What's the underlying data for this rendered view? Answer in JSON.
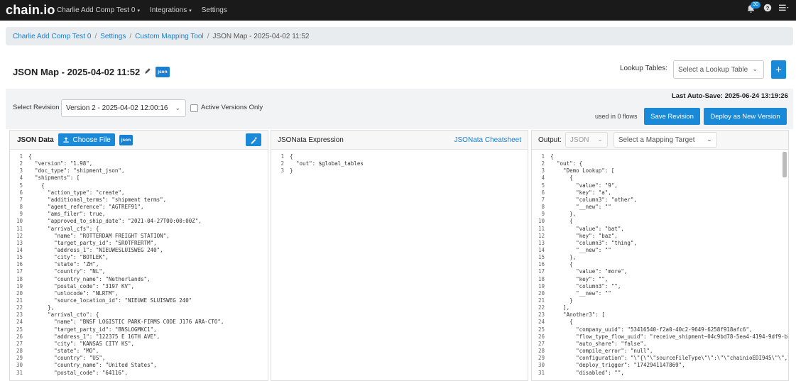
{
  "topbar": {
    "logo": "chain.io",
    "nav": [
      {
        "label": "Charlie Add Comp Test 0",
        "caret": true
      },
      {
        "label": "Integrations",
        "caret": true
      },
      {
        "label": "Settings",
        "caret": false
      }
    ],
    "notif_count": "30"
  },
  "breadcrumb": [
    "Charlie Add Comp Test 0",
    "Settings",
    "Custom Mapping Tool",
    "JSON Map - 2025-04-02 11:52"
  ],
  "header": {
    "title": "JSON Map - 2025-04-02 11:52",
    "tag": "json",
    "lookup_label": "Lookup Tables:",
    "lookup_placeholder": "Select a Lookup Table"
  },
  "toolbar": {
    "revision_label": "Select Revision",
    "revision_value": "Version 2 - 2025-04-02 12:00:16",
    "active_only_label": "Active Versions Only",
    "autosave": "Last Auto-Save: 2025-06-24 13:19:26",
    "flows": "used in 0 flows",
    "save_label": "Save Revision",
    "deploy_label": "Deploy as New Version"
  },
  "panels": {
    "json_data": {
      "title": "JSON Data",
      "choose_file": "Choose File",
      "tag": "json",
      "lines": [
        "{",
        "  \"version\": \"1.98\",",
        "  \"doc_type\": \"shipment_json\",",
        "  \"shipments\": [",
        "    {",
        "      \"action_type\": \"create\",",
        "      \"additional_terms\": \"shipment terms\",",
        "      \"agent_reference\": \"AGTREF91\",",
        "      \"ams_filer\": true,",
        "      \"approved_to_ship_date\": \"2021-04-27T00:00:00Z\",",
        "      \"arrival_cfs\": {",
        "        \"name\": \"ROTTERDAM FREIGHT STATION\",",
        "        \"target_party_id\": \"SROTFRERTM\",",
        "        \"address_1\": \"NIEUWESLUISWEG 240\",",
        "        \"city\": \"BOTLEK\",",
        "        \"state\": \"ZH\",",
        "        \"country\": \"NL\",",
        "        \"country_name\": \"Netherlands\",",
        "        \"postal_code\": \"3197 KV\",",
        "        \"unlocode\": \"NLRTM\",",
        "        \"source_location_id\": \"NIEUWE SLUISWEG 240\"",
        "      },",
        "      \"arrival_cto\": {",
        "        \"name\": \"BNSF LOGISTIC PARK-FIRMS CODE J176 ARA-CTO\",",
        "        \"target_party_id\": \"BNSLOGMKC1\",",
        "        \"address_1\": \"122375 E 16TH AVE\",",
        "        \"city\": \"KANSAS CITY KS\",",
        "        \"state\": \"MO\",",
        "        \"country\": \"US\",",
        "        \"country_name\": \"United States\",",
        "        \"postal_code\": \"64116\","
      ]
    },
    "jsonata": {
      "title": "JSONata Expression",
      "cheatsheet": "JSONata Cheatsheet",
      "lines": [
        "{",
        "  \"out\": $global_tables",
        "}"
      ]
    },
    "output": {
      "title": "Output:",
      "format": "JSON",
      "target_placeholder": "Select a Mapping Target",
      "lines": [
        "{",
        "  \"out\": {",
        "    \"Demo Lookup\": [",
        "      {",
        "        \"value\": \"9\",",
        "        \"key\": \"a\",",
        "        \"column3\": \"other\",",
        "        \"__new\": \"\"",
        "      },",
        "      {",
        "        \"value\": \"bat\",",
        "        \"key\": \"baz\",",
        "        \"column3\": \"thing\",",
        "        \"__new\": \"\"",
        "      },",
        "      {",
        "        \"value\": \"more\",",
        "        \"key\": \"\",",
        "        \"column3\": \"\",",
        "        \"__new\": \"\"",
        "      }",
        "    ],",
        "    \"Another3\": [",
        "      {",
        "        \"company_uuid\": \"53416540-f2a0-40c2-9649-6258f918afc6\",",
        "        \"flow_type_flow_uuid\": \"receive_shipment~04c9bd78-5ea4-4194-9df9-b72c",
        "        \"auto_share\": \"false\",",
        "        \"compile_error\": \"null\",",
        "        \"configuration\": \"\\\"{\\\"\\\"sourceFileType\\\"\\\":\\\"\\\"chainioEDI945\\\"\\\",\\\"",
        "        \"deploy_trigger\": \"1742941147869\",",
        "        \"disabled\": \"\","
      ]
    }
  }
}
